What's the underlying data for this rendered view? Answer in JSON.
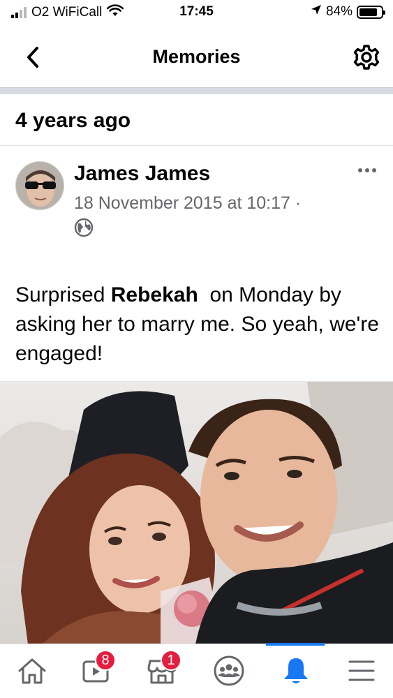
{
  "status_bar": {
    "carrier": "O2 WiFiCall",
    "time": "17:45",
    "battery": "84%",
    "battery_level": 0.84
  },
  "header": {
    "title": "Memories",
    "back_icon": "chevron-left-icon",
    "settings_icon": "gear-icon"
  },
  "section": {
    "title": "4 years ago"
  },
  "post": {
    "author": "James James",
    "timestamp": "18 November 2015 at 10:17 ·",
    "privacy_icon": "globe-icon",
    "text_before": "Surprised ",
    "tagged_person": "Rebekah",
    "text_after": "  on Monday by asking her to marry me. So yeah, we're engaged!"
  },
  "tab_bar": {
    "tabs": [
      {
        "icon": "home-icon"
      },
      {
        "icon": "watch-icon",
        "badge": "8"
      },
      {
        "icon": "marketplace-icon",
        "badge": "1"
      },
      {
        "icon": "groups-icon"
      },
      {
        "icon": "bell-icon",
        "active": true
      },
      {
        "icon": "menu-icon"
      }
    ]
  },
  "colors": {
    "accent": "#1877f2",
    "badge": "#e41e3f",
    "secondary_text": "#65676b"
  }
}
